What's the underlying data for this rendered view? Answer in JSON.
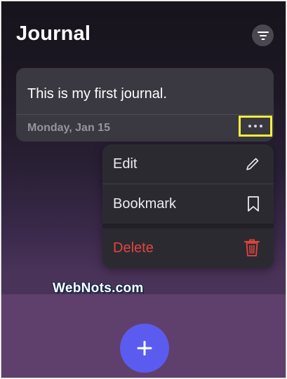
{
  "header": {
    "title": "Journal",
    "filter_icon": "filter-lines-icon"
  },
  "entry": {
    "text": "This is my first journal.",
    "date": "Monday, Jan 15",
    "more_icon": "ellipsis-icon"
  },
  "menu": {
    "items": [
      {
        "label": "Edit",
        "icon": "pencil-icon"
      },
      {
        "label": "Bookmark",
        "icon": "bookmark-icon"
      },
      {
        "label": "Delete",
        "icon": "trash-icon",
        "color": "#e2453e"
      }
    ]
  },
  "watermark": "WebNots.com",
  "fab": {
    "icon": "plus-icon",
    "color": "#5c5bf0"
  },
  "colors": {
    "highlight": "#f2f23a",
    "accent": "#5c5bf0",
    "danger": "#e2453e"
  }
}
